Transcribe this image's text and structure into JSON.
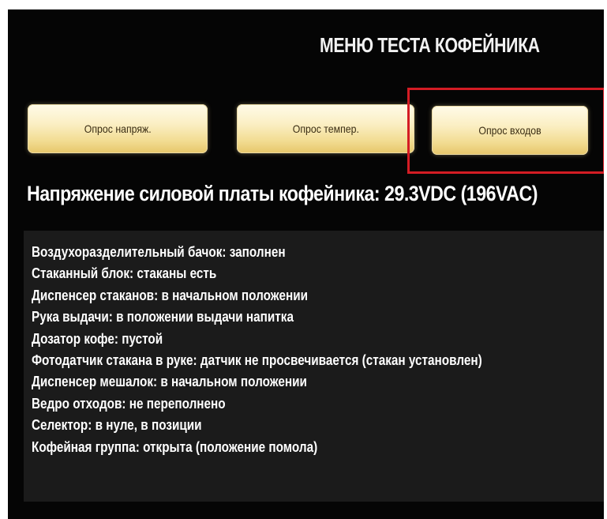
{
  "header": {
    "title": "МЕНЮ ТЕСТА КОФЕЙНИКА"
  },
  "buttons": [
    {
      "label": "Опрос напряж."
    },
    {
      "label": "Опрос темпер."
    },
    {
      "label": "Опрос входов"
    }
  ],
  "highlight_color": "#d41c24",
  "voltage": {
    "text": "Напряжение силовой платы кофейника: 29.3VDC (196VAC)"
  },
  "inputs_status": [
    "Воздухоразделительный бачок: заполнен",
    "Стаканный блок: стаканы есть",
    "Диспенсер стаканов: в начальном положении",
    "Рука выдачи: в положении выдачи напитка",
    "Дозатор кофе: пустой",
    "Фотодатчик стакана в руке: датчик не просвечивается (стакан установлен)",
    "Диспенсер мешалок: в начальном положении",
    "Ведро отходов: не переполнено",
    "Селектор: в нуле, в позиции",
    "Кофейная группа: открыта (положение помола)"
  ]
}
